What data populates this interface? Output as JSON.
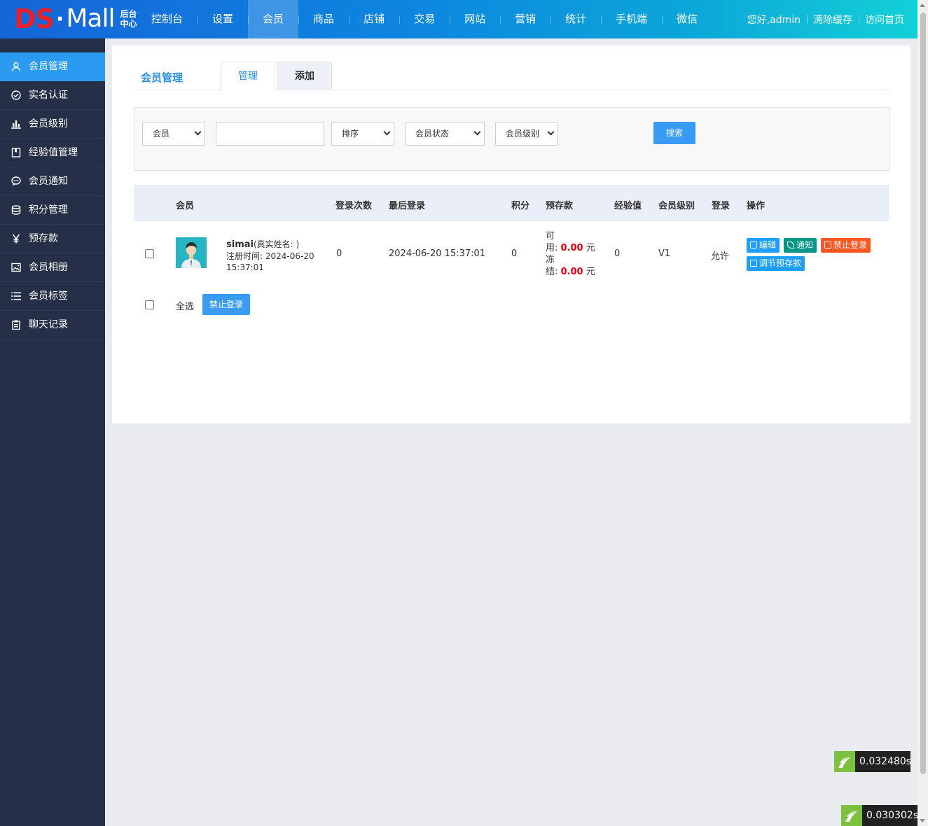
{
  "logo": {
    "ds": "DS",
    "dot": "·",
    "mall": "Mall",
    "sub": "后台中心"
  },
  "nav": [
    "控制台",
    "设置",
    "会员",
    "商品",
    "店铺",
    "交易",
    "网站",
    "营销",
    "统计",
    "手机端",
    "微信"
  ],
  "nav_active": "会员",
  "top_links": [
    "您好,admin",
    "清除缓存",
    "访问首页"
  ],
  "sidebar": [
    {
      "label": "会员管理",
      "icon": "user-icon"
    },
    {
      "label": "实名认证",
      "icon": "check-circle-icon"
    },
    {
      "label": "会员级别",
      "icon": "bar-chart-icon"
    },
    {
      "label": "经验值管理",
      "icon": "book-icon"
    },
    {
      "label": "会员通知",
      "icon": "message-icon"
    },
    {
      "label": "积分管理",
      "icon": "database-icon"
    },
    {
      "label": "预存款",
      "icon": "yen-icon"
    },
    {
      "label": "会员相册",
      "icon": "image-icon"
    },
    {
      "label": "会员标签",
      "icon": "list-icon"
    },
    {
      "label": "聊天记录",
      "icon": "clipboard-icon"
    }
  ],
  "page": {
    "title": "会员管理",
    "tabs": [
      "管理",
      "添加"
    ]
  },
  "search": {
    "member_select": "会员",
    "keyword_value": "",
    "sort_select": "排序",
    "status_select": "会员状态",
    "level_select": "会员级别",
    "button": "搜索"
  },
  "table": {
    "headers": [
      "会员",
      "登录次数",
      "最后登录",
      "积分",
      "预存款",
      "经验值",
      "会员级别",
      "登录",
      "操作"
    ],
    "rows": [
      {
        "username": "simai",
        "realname": "(真实姓名: )",
        "reg_label": "注册时间: 2024-06-20",
        "reg_time": "15:37:01",
        "login_count": "0",
        "last_login": "2024-06-20 15:37:01",
        "points": "0",
        "avail_label_1": "可",
        "avail_label_2": "用: ",
        "avail_value": "0.00",
        "frozen_label_1": "冻",
        "frozen_label_2": "结: ",
        "frozen_value": "0.00",
        "currency": "元",
        "exp": "0",
        "level": "V1",
        "login": "允许",
        "actions": [
          "编辑",
          "通知",
          "禁止登录",
          "调节预存款"
        ]
      }
    ]
  },
  "footer": {
    "select_all": "全选",
    "ban_button": "禁止登录"
  },
  "timers": [
    "0.032480s",
    "0.030302s"
  ]
}
